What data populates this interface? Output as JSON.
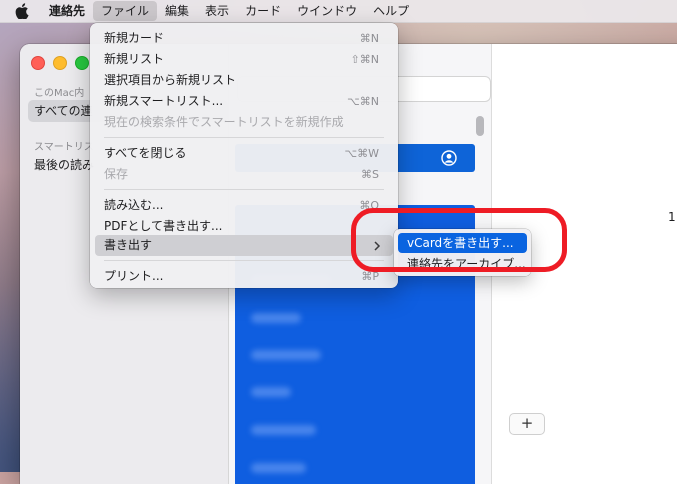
{
  "menubar": {
    "app_name": "連絡先",
    "items": [
      "ファイル",
      "編集",
      "表示",
      "カード",
      "ウインドウ",
      "ヘルプ"
    ]
  },
  "sidebar": {
    "section_mac": "このMac内",
    "item_all": "すべての連",
    "section_smart": "スマートリス",
    "item_recent": "最後の読み"
  },
  "detail": {
    "number": "1",
    "add_label": "+"
  },
  "file_menu": {
    "items": [
      {
        "label": "新規カード",
        "shortcut": "⌘N",
        "enabled": true
      },
      {
        "label": "新規リスト",
        "shortcut": "⇧⌘N",
        "enabled": true
      },
      {
        "label": "選択項目から新規リスト",
        "shortcut": "",
        "enabled": true
      },
      {
        "label": "新規スマートリスト...",
        "shortcut": "⌥⌘N",
        "enabled": true
      },
      {
        "label": "現在の検索条件でスマートリストを新規作成",
        "shortcut": "",
        "enabled": false
      },
      {
        "label": "すべてを閉じる",
        "shortcut": "⌥⌘W",
        "enabled": true
      },
      {
        "label": "保存",
        "shortcut": "⌘S",
        "enabled": false
      },
      {
        "label": "読み込む...",
        "shortcut": "⌘O",
        "enabled": true
      },
      {
        "label": "PDFとして書き出す...",
        "shortcut": "",
        "enabled": true
      },
      {
        "label": "書き出す",
        "shortcut": "",
        "enabled": true,
        "submenu": true
      },
      {
        "label": "プリント...",
        "shortcut": "⌘P",
        "enabled": true
      }
    ]
  },
  "export_submenu": {
    "items": [
      "vCardを書き出す...",
      "連絡先をアーカイブ..."
    ],
    "highlighted": "vCardを書き出す..."
  },
  "colors": {
    "highlight": "#0a64e0",
    "annotation": "#ee1c25",
    "contact_selection": "#0f5ee0"
  },
  "icons": {
    "apple": "apple-logo-icon",
    "me_card": "person-circle-icon",
    "submenu_arrow": "chevron-right-icon"
  }
}
